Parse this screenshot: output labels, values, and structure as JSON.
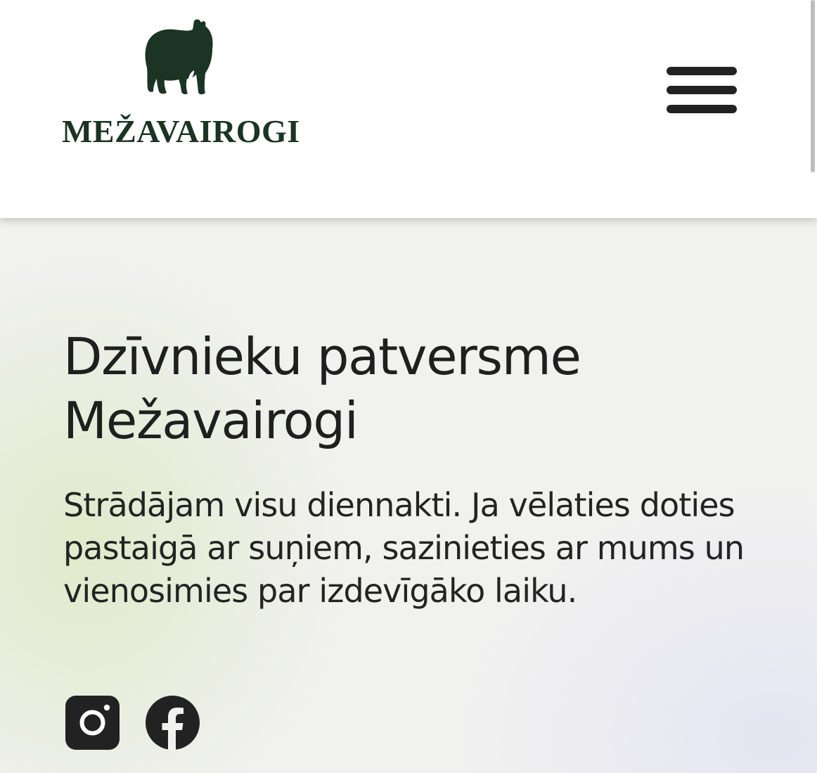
{
  "header": {
    "logo_text": "MEŽAVAIROGI",
    "menu_icon": "hamburger-menu-icon"
  },
  "hero": {
    "title_line1": "Dzīvnieku patversme",
    "title_line2": "Mežavairogi",
    "description": "Strādājam visu diennakti. Ja vēlaties doties pastaigā ar suņiem, sazinieties ar mums un vienosimies par izdevīgāko laiku."
  },
  "social": [
    {
      "icon": "instagram-icon"
    },
    {
      "icon": "facebook-icon"
    }
  ],
  "colors": {
    "brand": "#1b3424",
    "text": "#1f1f1f",
    "icon": "#222222"
  }
}
